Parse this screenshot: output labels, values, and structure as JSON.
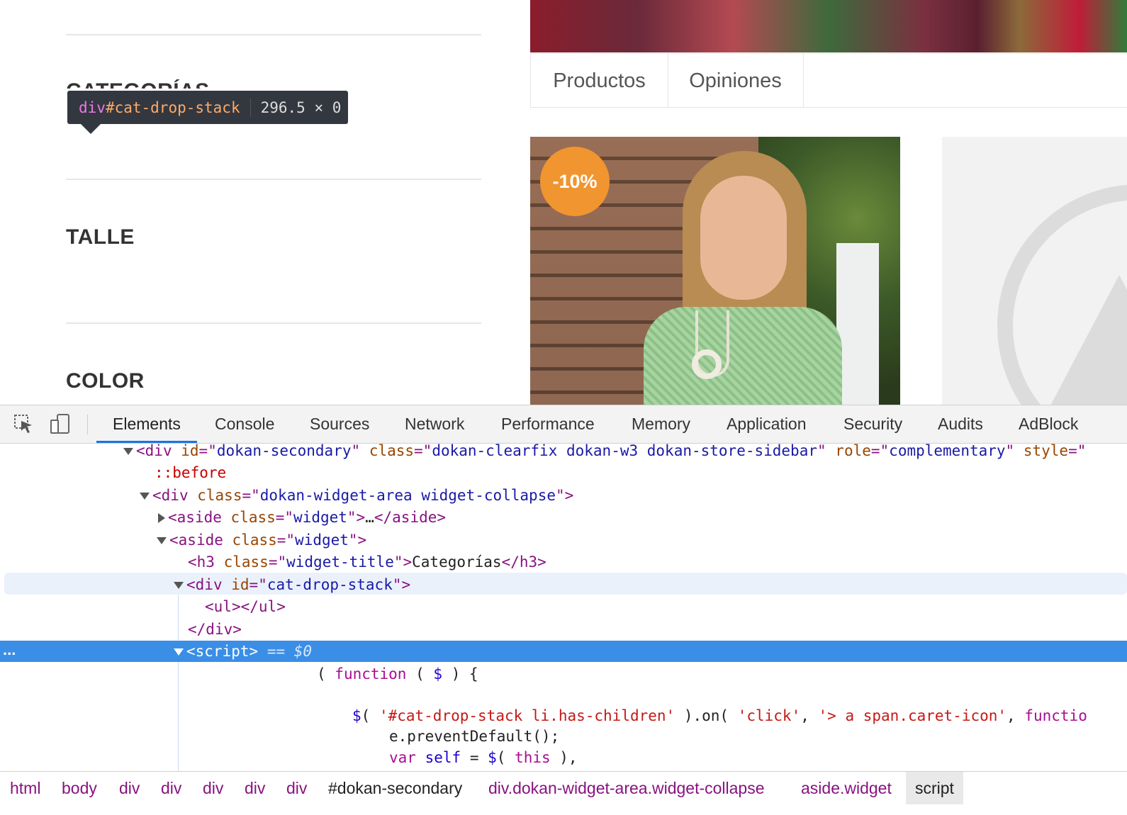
{
  "sidebar": {
    "categories_title": "CATEGORÍAS",
    "talle_title": "TALLE",
    "color_title": "COLOR"
  },
  "tooltip": {
    "tag": "div",
    "id": "#cat-drop-stack",
    "size": "296.5 × 0"
  },
  "store": {
    "tabs": [
      "Productos",
      "Opiniones"
    ],
    "discount_badge": "-10%"
  },
  "devtools": {
    "tabs": [
      "Elements",
      "Console",
      "Sources",
      "Network",
      "Performance",
      "Memory",
      "Application",
      "Security",
      "Audits",
      "AdBlock"
    ],
    "active_tab": "Elements",
    "dom": {
      "l1_tag": "div",
      "l1_attr1": "id",
      "l1_val1": "dokan-secondary",
      "l1_attr2": "class",
      "l1_val2": "dokan-clearfix dokan-w3 dokan-store-sidebar",
      "l1_attr3": "role",
      "l1_val3": "complementary",
      "l1_attr4": "style",
      "l2_pseudo": "::before",
      "l3_tag": "div",
      "l3_attr": "class",
      "l3_val": "dokan-widget-area widget-collapse",
      "l4_tag": "aside",
      "l4_attr": "class",
      "l4_val": "widget",
      "l4_ellipsis": "…",
      "l4_close": "aside",
      "l5_tag": "aside",
      "l5_attr": "class",
      "l5_val": "widget",
      "l6_tag": "h3",
      "l6_attr": "class",
      "l6_val": "widget-title",
      "l6_text": "Categorías",
      "l6_close": "h3",
      "l7_tag": "div",
      "l7_attr": "id",
      "l7_val": "cat-drop-stack",
      "l8_open": "ul",
      "l8_close": "ul",
      "l9_close": "div",
      "l10_tag": "script",
      "l10_eq": "== $0",
      "js1_fn": "function",
      "js1_arg": "$",
      "js2_sel": "'#cat-drop-stack li.has-children'",
      "js2_on": ".on(",
      "js2_ev": "'click'",
      "js2_sub": "'> a span.caret-icon'",
      "js2_fn": "functio",
      "js3": "e.preventDefault();",
      "js4_var": "var",
      "js4_name": "self",
      "js4_this": "this"
    },
    "breadcrumb": [
      "html",
      "body",
      "div",
      "div",
      "div",
      "div",
      "div",
      "#dokan-secondary",
      "div.dokan-widget-area.widget-collapse",
      "aside.widget",
      "script"
    ],
    "more_dots": "..."
  }
}
